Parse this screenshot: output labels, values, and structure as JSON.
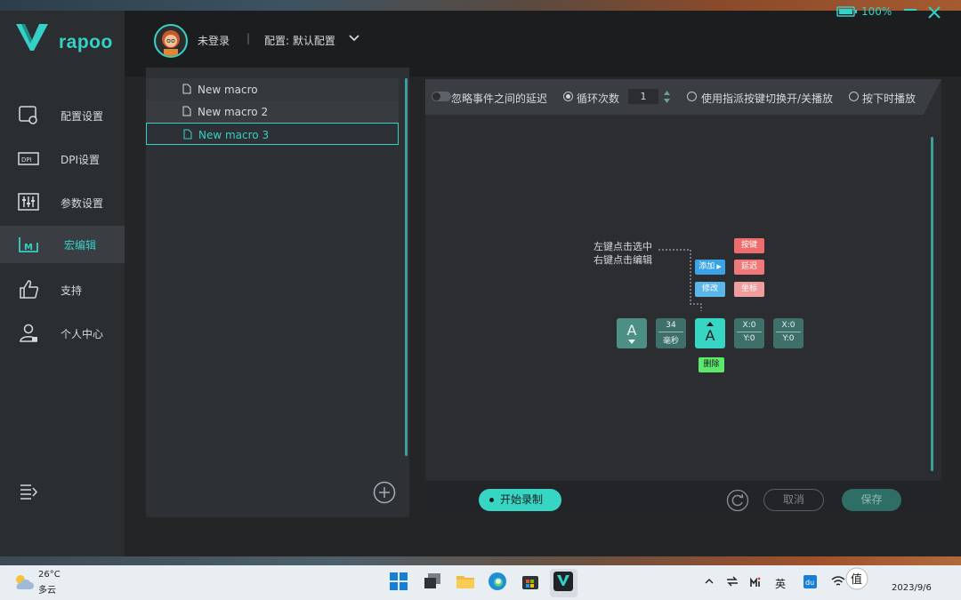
{
  "app": {
    "brand": "rapoo",
    "battery": "100%",
    "user_status": "未登录",
    "separator": "|",
    "profile": "配置: 默认配置"
  },
  "sidebar": {
    "items": [
      {
        "label": "配置设置",
        "icon": "config-icon"
      },
      {
        "label": "DPI设置",
        "icon": "dpi-icon"
      },
      {
        "label": "参数设置",
        "icon": "sliders-icon"
      },
      {
        "label": "宏编辑",
        "icon": "macro-icon",
        "active": true
      },
      {
        "label": "支持",
        "icon": "thumbs-up-icon"
      },
      {
        "label": "个人中心",
        "icon": "user-icon"
      }
    ]
  },
  "macros": {
    "items": [
      "New macro",
      "New macro 2",
      "New macro 3"
    ],
    "selected": "New macro 3"
  },
  "editor": {
    "ignore_delay": "忽略事件之间的延迟",
    "loop_label": "循环次数",
    "loop_count": "1",
    "toggle_mode": "使用指派按键切换开/关播放",
    "hold_mode": "按下时播放",
    "hint_line1": "左键点击选中",
    "hint_line2": "右键点击编辑",
    "blocks": {
      "key_a": "A",
      "delay_value": "34",
      "delay_unit": "毫秒",
      "key_a_up": "A",
      "x1": "X:0",
      "y1": "Y:0",
      "x2": "X:0",
      "y2": "Y:0"
    },
    "menu": {
      "add": "添加",
      "modify": "修改",
      "key": "按键",
      "delay": "延迟",
      "coord": "坐标",
      "delete": "删除"
    },
    "record": "开始录制",
    "cancel": "取消",
    "save": "保存"
  },
  "taskbar": {
    "temperature": "26°C",
    "condition": "多云",
    "ime": "英",
    "date": "2023/9/6"
  },
  "colors": {
    "accent": "#35d0c6",
    "panel": "#2d3034",
    "delete": "#5ce86a",
    "red_menu": "#ee6c6c",
    "blue_menu": "#3aa2e6"
  }
}
